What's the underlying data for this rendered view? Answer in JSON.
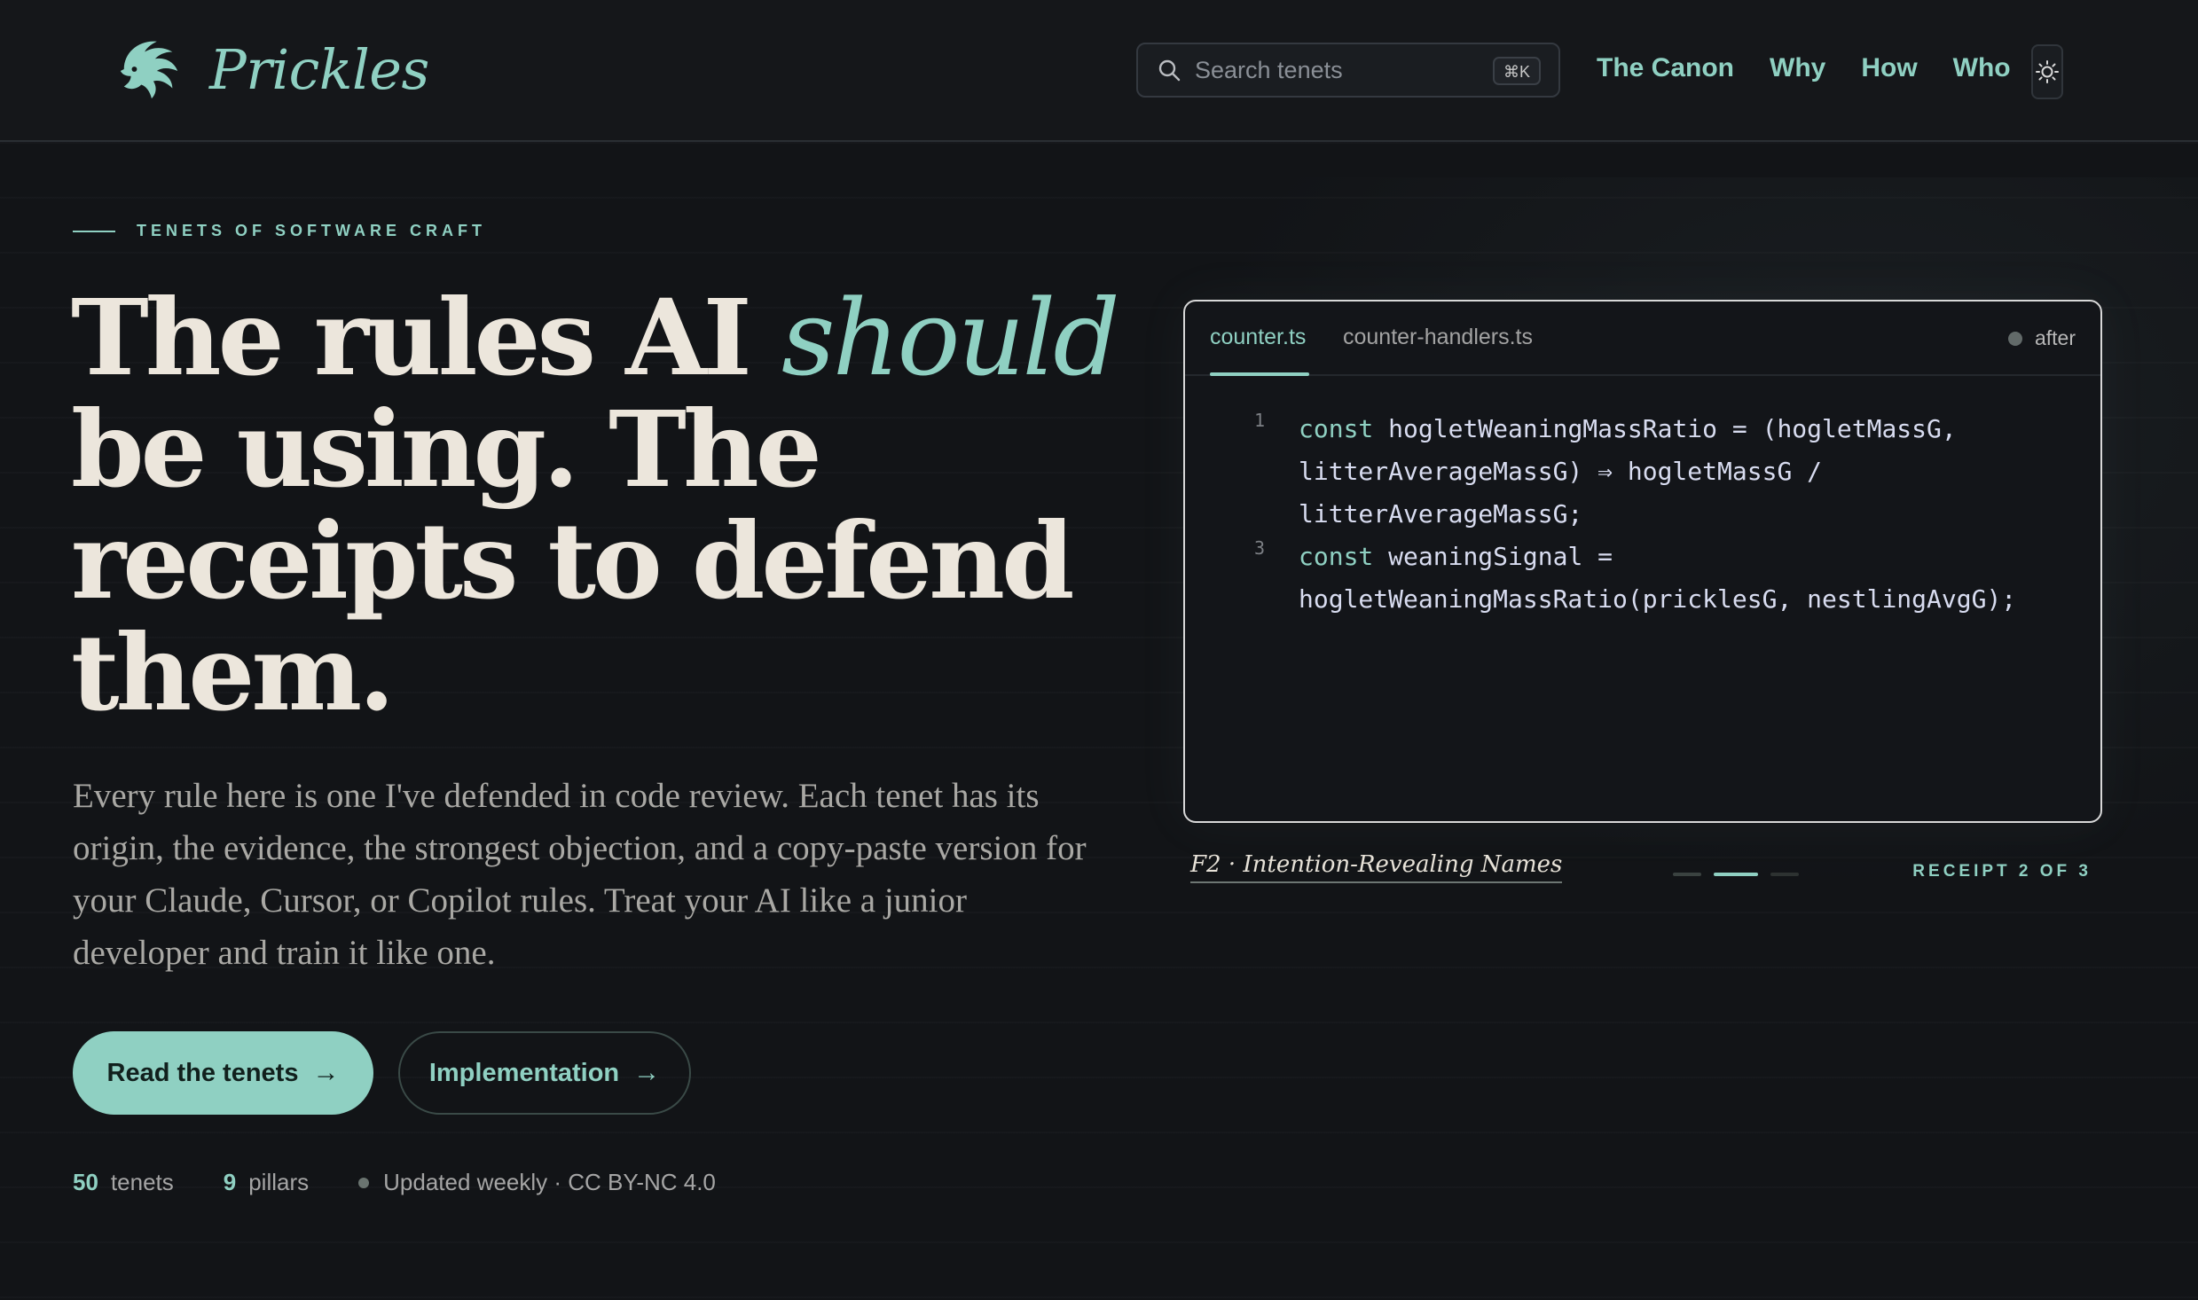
{
  "header": {
    "brand_name": "Prickles",
    "search_placeholder": "Search tenets",
    "search_shortcut": "⌘K",
    "nav": [
      "The Canon",
      "Why",
      "How",
      "Who"
    ]
  },
  "hero": {
    "eyebrow": "TENETS OF SOFTWARE CRAFT",
    "headline_before": "The rules AI ",
    "headline_emphasis": "should",
    "headline_after": " be using. The receipts to defend them.",
    "lede": "Every rule here is one I've defended in code review. Each tenet has its origin, the evidence, the strongest objection, and a copy-paste version for your Claude, Cursor, or Copilot rules. Treat your AI like a junior developer and train it like one.",
    "primary_cta": "Read the tenets",
    "secondary_cta": "Implementation",
    "stats": {
      "tenets_count": "50",
      "tenets_label": "tenets",
      "pillars_count": "9",
      "pillars_label": "pillars",
      "updated": "Updated weekly · CC BY-NC 4.0"
    }
  },
  "code_card": {
    "tabs": [
      "counter.ts",
      "counter-handlers.ts"
    ],
    "active_tab": "counter.ts",
    "state_label": "after",
    "lines": [
      {
        "num": "1",
        "kw": "const",
        "rest": " hogletWeaningMassRatio = (hogletMassG,"
      },
      {
        "num": "",
        "kw": "",
        "rest": "litterAverageMassG) ⇒ hogletMassG /"
      },
      {
        "num": "",
        "kw": "",
        "rest": "litterAverageMassG;"
      },
      {
        "num": "3",
        "kw": "const",
        "rest": " weaningSignal ="
      },
      {
        "num": "",
        "kw": "",
        "rest": "hogletWeaningMassRatio(pricklesG, nestlingAvgG);"
      }
    ]
  },
  "caption": {
    "title": "F2 · Intention-Revealing Names",
    "receipt": "RECEIPT 2 OF 3",
    "current_receipt": 2,
    "total_receipts": 3
  },
  "colors": {
    "accent": "#8fd0c2",
    "background": "#121417",
    "headline": "#ece6dc"
  }
}
